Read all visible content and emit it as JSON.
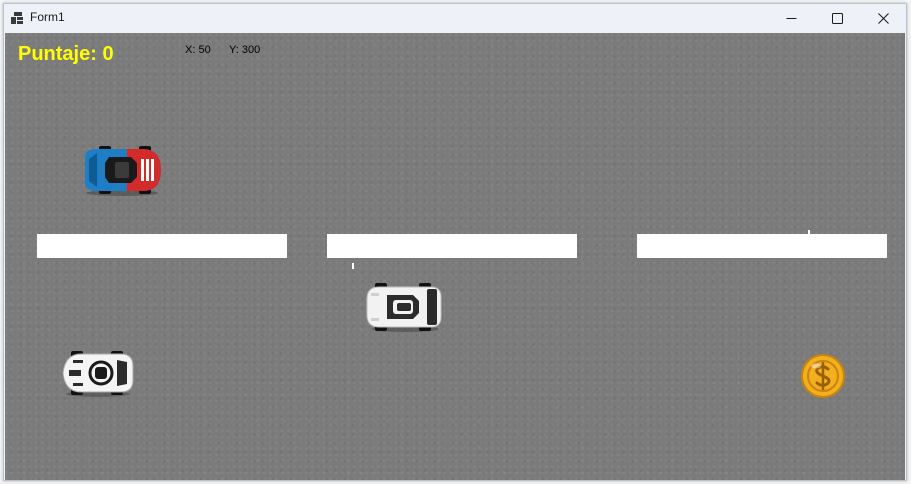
{
  "window": {
    "title": "Form1",
    "icon": "winforms-app-icon",
    "controls": [
      "minimize-icon",
      "maximize-icon",
      "close-icon"
    ]
  },
  "game": {
    "score_text": "Puntaje: 0",
    "x_text": "X: 50",
    "y_text": "Y: 300",
    "colors": {
      "road": "#7b7b7b",
      "lane_marker": "#ffffff",
      "score": "#ffff00",
      "coin": "#f2b01e"
    },
    "sprites": [
      "enemy-car-blue",
      "enemy-car-white",
      "player-car-white",
      "dollar-coin"
    ]
  }
}
